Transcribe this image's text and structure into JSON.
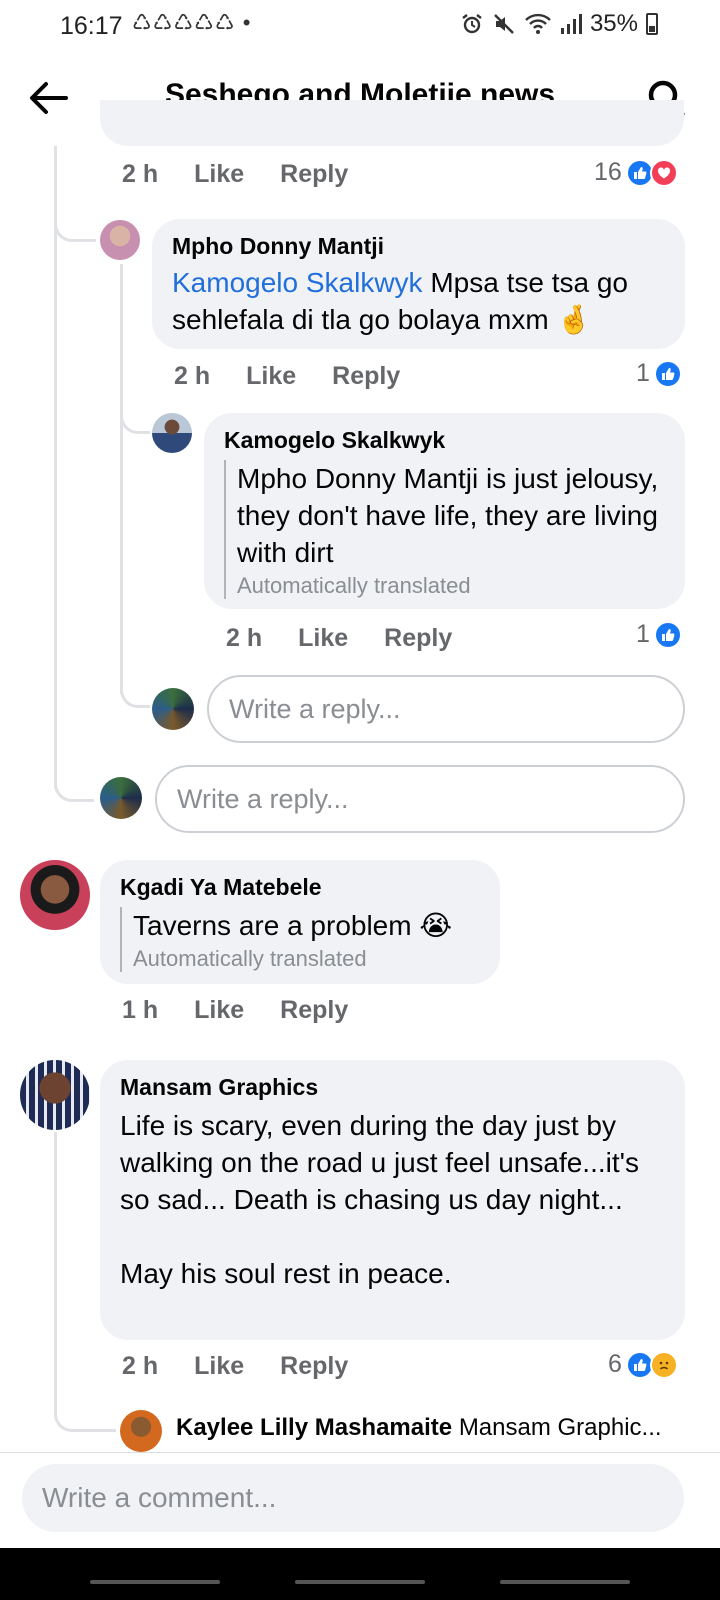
{
  "status_bar": {
    "time": "16:17",
    "notifications": "♺♺♺♺♺ •",
    "icons": [
      "alarm-icon",
      "mute-icon",
      "wifi-icon",
      "signal-icon"
    ],
    "battery": "35%"
  },
  "app_bar": {
    "title": "Seshego and Moletjie news"
  },
  "thread": {
    "top_comment_meta": {
      "time": "2 h",
      "like": "Like",
      "reply": "Reply",
      "reactions": "16"
    },
    "reply1": {
      "author": "Mpho Donny Mantji",
      "mention": "Kamogelo Skalkwyk",
      "text": "Mpsa tse tsa go sehlefala di tla go bolaya  mxm",
      "emoji": "🤞",
      "time": "2 h",
      "like": "Like",
      "reply": "Reply",
      "reactions": "1"
    },
    "reply2": {
      "author": "Kamogelo Skalkwyk",
      "text": "Mpho Donny Mantji is just jelousy, they don't have life, they are living with dirt",
      "auto_translated": "Automatically translated",
      "time": "2 h",
      "like": "Like",
      "reply": "Reply",
      "reactions": "1"
    },
    "reply_box_inner": "Write a reply...",
    "reply_box_outer": "Write a reply..."
  },
  "comment_kgadi": {
    "author": "Kgadi Ya Matebele",
    "text": "Taverns are a problem",
    "emoji": "😭",
    "auto_translated": "Automatically translated",
    "time": "1 h",
    "like": "Like",
    "reply": "Reply"
  },
  "comment_mansam": {
    "author": "Mansam Graphics",
    "text_1": "Life is scary, even during the day just by walking on the road u just feel unsafe...it's so sad... Death is chasing us day night...",
    "text_2": "May his soul rest in peace.",
    "time": "2 h",
    "like": "Like",
    "reply": "Reply",
    "reactions": "6"
  },
  "reply_preview": {
    "author": "Kaylee Lilly Mashamaite",
    "text": "Mansam Graphic..."
  },
  "comment_input": {
    "placeholder": "Write a comment..."
  },
  "colors": {
    "accent": "#1877f2",
    "mention": "#216fdb",
    "bubble": "#f0f2f5",
    "meta": "#65676b",
    "love": "#f33e58"
  }
}
